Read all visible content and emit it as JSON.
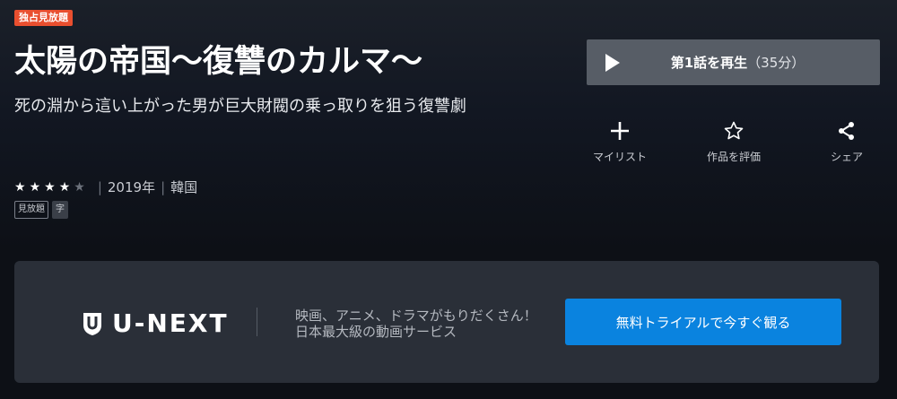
{
  "badge": "独占見放題",
  "title": "太陽の帝国～復讐のカルマ～",
  "synopsis": "死の淵から這い上がった男が巨大財閥の乗っ取りを狙う復讐劇",
  "rating": {
    "stars_filled": 4,
    "stars_total": 5
  },
  "meta": {
    "year": "2019年",
    "country": "韓国",
    "separator": "|"
  },
  "tags": [
    "見放題",
    "字"
  ],
  "play": {
    "label": "第1話を再生",
    "duration": "（35分）"
  },
  "actions": [
    {
      "label": "マイリスト",
      "icon": "plus-icon"
    },
    {
      "label": "作品を評価",
      "icon": "star-outline-icon"
    },
    {
      "label": "シェア",
      "icon": "share-icon"
    }
  ],
  "banner": {
    "logo_text": "U-NEXT",
    "promo_line1": "映画、アニメ、ドラマがもりだくさん！",
    "promo_line2": "日本最大級の動画サービス",
    "cta_label": "無料トライアルで今すぐ観る"
  },
  "colors": {
    "accent_badge": "#e94f2f",
    "cta": "#0a83df",
    "play_bg": "#575d66"
  }
}
